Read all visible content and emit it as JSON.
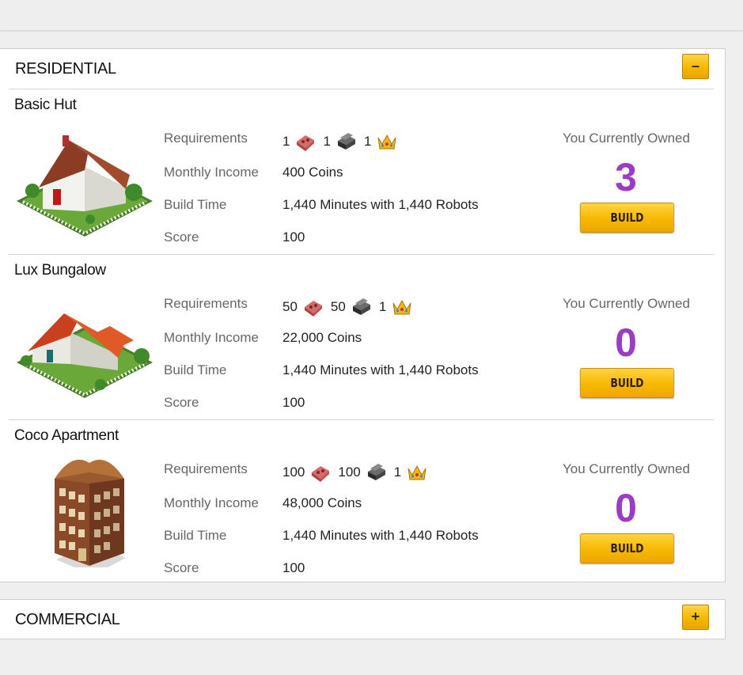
{
  "sections": {
    "residential": {
      "title": "RESIDENTIAL",
      "toggle": "–"
    },
    "commercial": {
      "title": "COMMERCIAL",
      "toggle": "+"
    }
  },
  "labels": {
    "requirements": "Requirements",
    "monthly_income": "Monthly Income",
    "build_time": "Build Time",
    "score": "Score",
    "owned": "You Currently Owned",
    "build": "BUILD"
  },
  "items": [
    {
      "name": "Basic Hut",
      "req": {
        "brick": "1",
        "iron": "1",
        "crown": "1"
      },
      "income": "400 Coins",
      "build_time": "1,440 Minutes with 1,440 Robots",
      "score": "100",
      "owned": "3"
    },
    {
      "name": "Lux Bungalow",
      "req": {
        "brick": "50",
        "iron": "50",
        "crown": "1"
      },
      "income": "22,000 Coins",
      "build_time": "1,440 Minutes with 1,440 Robots",
      "score": "100",
      "owned": "0"
    },
    {
      "name": "Coco Apartment",
      "req": {
        "brick": "100",
        "iron": "100",
        "crown": "1"
      },
      "income": "48,000 Coins",
      "build_time": "1,440 Minutes with 1,440 Robots",
      "score": "100",
      "owned": "0"
    }
  ],
  "icons": {
    "brick": "brick-icon",
    "iron": "iron-ingot-icon",
    "crown": "crown-icon"
  },
  "colors": {
    "owned_count": "#9b3cc4",
    "button_gold": "#f7b800"
  }
}
